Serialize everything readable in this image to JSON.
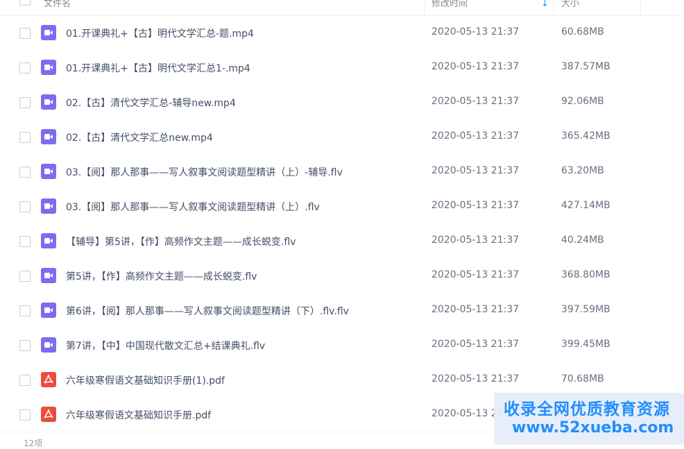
{
  "header": {
    "col_name": "文件名",
    "col_time": "修改时间",
    "col_size": "大小",
    "sort_icon": "arrow-down-icon"
  },
  "files": [
    {
      "type": "video",
      "icon": "video-file-icon",
      "name": "01.开课典礼+【古】明代文学汇总-题.mp4",
      "time": "2020-05-13 21:37",
      "size": "60.68MB"
    },
    {
      "type": "video",
      "icon": "video-file-icon",
      "name": "01.开课典礼+【古】明代文学汇总1-.mp4",
      "time": "2020-05-13 21:37",
      "size": "387.57MB"
    },
    {
      "type": "video",
      "icon": "video-file-icon",
      "name": "02.【古】清代文学汇总-辅导new.mp4",
      "time": "2020-05-13 21:37",
      "size": "92.06MB"
    },
    {
      "type": "video",
      "icon": "video-file-icon",
      "name": "02.【古】清代文学汇总new.mp4",
      "time": "2020-05-13 21:37",
      "size": "365.42MB"
    },
    {
      "type": "video",
      "icon": "video-file-icon",
      "name": "03.【阅】那人那事——写人叙事文阅读题型精讲（上）-辅导.flv",
      "time": "2020-05-13 21:37",
      "size": "63.20MB"
    },
    {
      "type": "video",
      "icon": "video-file-icon",
      "name": "03.【阅】那人那事——写人叙事文阅读题型精讲（上）.flv",
      "time": "2020-05-13 21:37",
      "size": "427.14MB"
    },
    {
      "type": "video",
      "icon": "video-file-icon",
      "name": "【辅导】第5讲，【作】高频作文主题——成长蜕变.flv",
      "time": "2020-05-13 21:37",
      "size": "40.24MB"
    },
    {
      "type": "video",
      "icon": "video-file-icon",
      "name": "第5讲，【作】高频作文主题——成长蜕变.flv",
      "time": "2020-05-13 21:37",
      "size": "368.80MB"
    },
    {
      "type": "video",
      "icon": "video-file-icon",
      "name": "第6讲，【阅】那人那事——写人叙事文阅读题型精讲（下）.flv.flv",
      "time": "2020-05-13 21:37",
      "size": "397.59MB"
    },
    {
      "type": "video",
      "icon": "video-file-icon",
      "name": "第7讲，【中】中国现代散文汇总+结课典礼.flv",
      "time": "2020-05-13 21:37",
      "size": "399.45MB"
    },
    {
      "type": "pdf",
      "icon": "pdf-file-icon",
      "name": "六年级寒假语文基础知识手册(1).pdf",
      "time": "2020-05-13 21:37",
      "size": "70.68MB"
    },
    {
      "type": "pdf",
      "icon": "pdf-file-icon",
      "name": "六年级寒假语文基础知识手册.pdf",
      "time": "2020-05-13 21:37",
      "size": ""
    }
  ],
  "footer": {
    "count": "12项"
  },
  "watermark": {
    "line1": "收录全网优质教育资源",
    "line2": "www.52xueba.com"
  },
  "colors": {
    "video_icon": "#7b6cf0",
    "pdf_icon": "#f0493e",
    "sort_arrow": "#1e90ff",
    "watermark_text": "#1a8bff"
  }
}
